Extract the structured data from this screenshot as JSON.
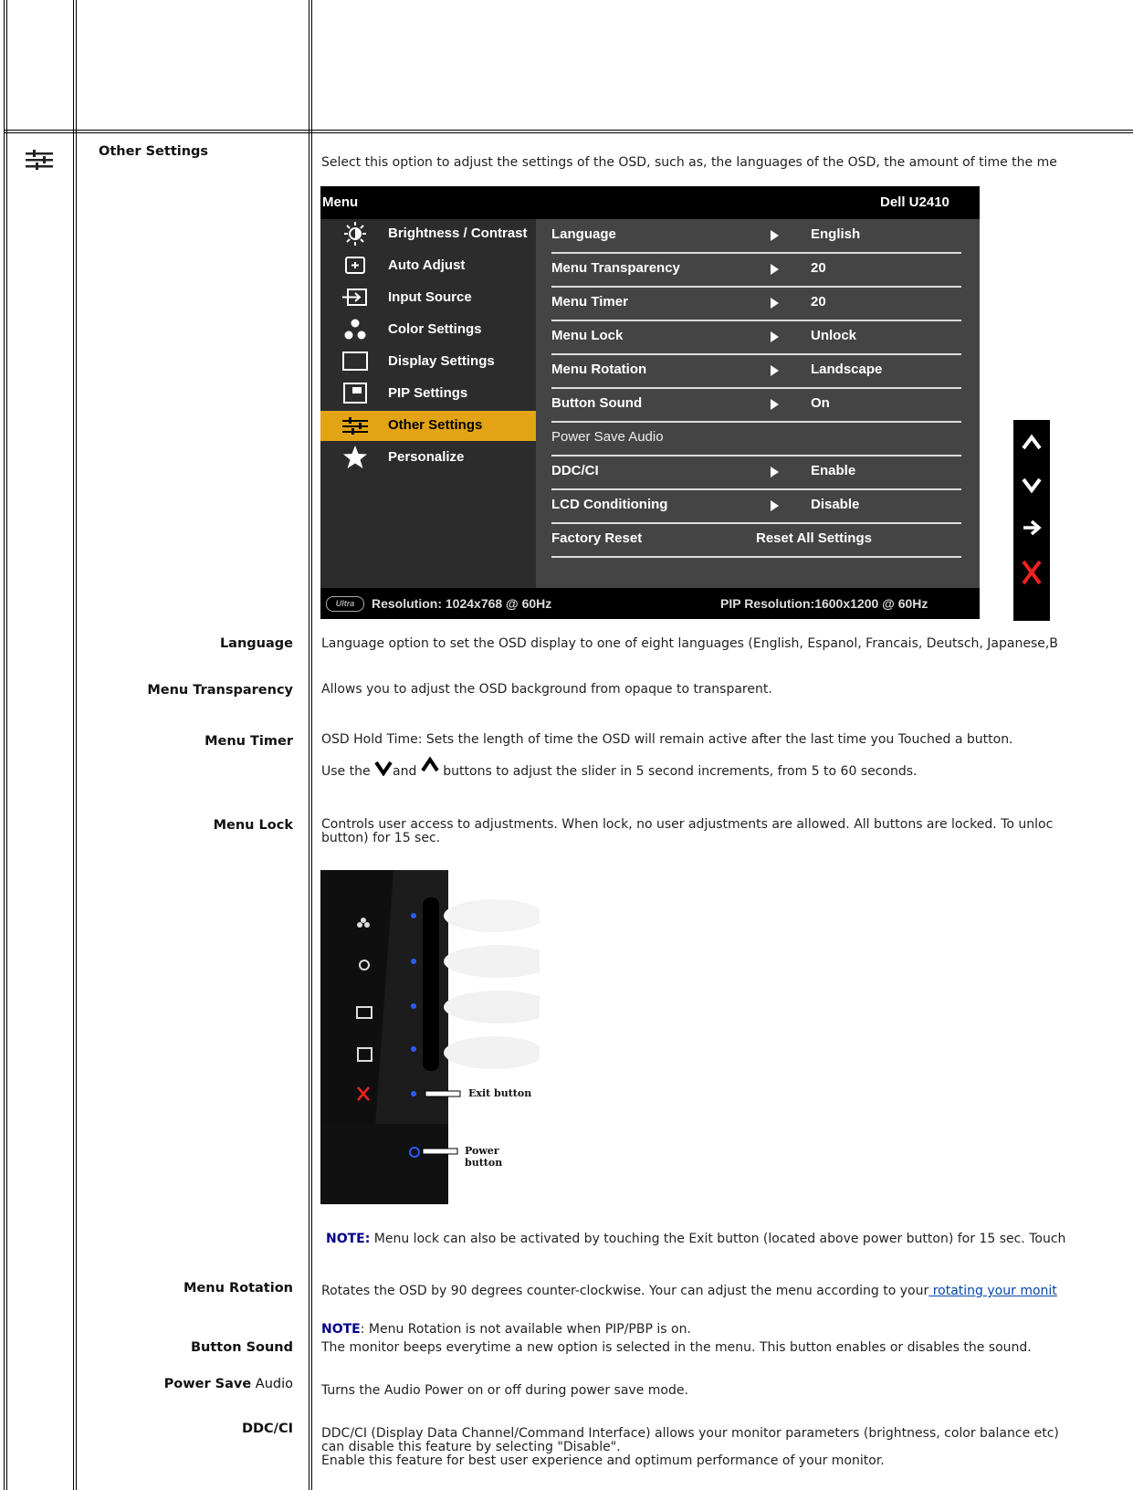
{
  "section": {
    "title": "Other Settings",
    "intro": "Select this option to adjust the settings of the OSD, such as, the languages of the OSD, the amount of time the me"
  },
  "icons": {
    "section": "other-settings-icon"
  },
  "osd": {
    "menu_title": "Menu",
    "model": "Dell U2410",
    "left_items": [
      {
        "label": "Brightness / Contrast"
      },
      {
        "label": "Auto Adjust"
      },
      {
        "label": "Input Source"
      },
      {
        "label": "Color Settings"
      },
      {
        "label": "Display Settings"
      },
      {
        "label": "PIP Settings"
      },
      {
        "label": "Other Settings"
      },
      {
        "label": "Personalize"
      }
    ],
    "rows": [
      {
        "key": "Language",
        "value": "English"
      },
      {
        "key": "Menu Transparency",
        "value": "20"
      },
      {
        "key": "Menu Timer",
        "value": "20"
      },
      {
        "key": "Menu Lock",
        "value": "Unlock"
      },
      {
        "key": "Menu Rotation",
        "value": "Landscape"
      },
      {
        "key": "Button Sound",
        "value": "On"
      },
      {
        "key": "Power Save Audio",
        "value": ""
      },
      {
        "key": "DDC/CI",
        "value": "Enable"
      },
      {
        "key": "LCD Conditioning",
        "value": "Disable"
      },
      {
        "key": "Factory Reset",
        "value": "Reset All Settings"
      }
    ],
    "footer_logo": "Ultra",
    "resolution": "Resolution: 1024x768 @ 60Hz",
    "pip_resolution": "PIP Resolution:1600x1200 @ 60Hz"
  },
  "items": {
    "language": {
      "label": "Language",
      "text": "Language option to set the OSD display to one of eight languages (English, Espanol, Francais, Deutsch, Japanese,B"
    },
    "transparency": {
      "label": "Menu Transparency",
      "text": "Allows you to adjust the OSD background from opaque to transparent."
    },
    "timer": {
      "label": "Menu Timer",
      "text1": "OSD Hold Time: Sets the length of time the OSD will remain active after the last time you Touched a button.",
      "text2a": "Use the",
      "text2b": "and",
      "text2c": "buttons to adjust the slider in 5 second increments, from 5 to 60 seconds."
    },
    "lock": {
      "label": "Menu Lock",
      "text": "Controls user access to adjustments. When lock, no user adjustments are allowed. All buttons are locked. To unloc",
      "text_cont": "button) for 15 sec.",
      "exit_button": "Exit button",
      "power_button": "Power button",
      "note_label": "NOTE:",
      "note": "Menu lock can also be activated by touching the Exit button (located above power button) for 15 sec. Touch"
    },
    "rotation": {
      "label": "Menu Rotation",
      "text": "Rotates the OSD by 90 degrees counter-clockwise. Your can adjust the menu according to your",
      "link": " rotating your monit",
      "note_label": "NOTE",
      "note": ": Menu Rotation is not available when PIP/PBP is on."
    },
    "sound": {
      "label": "Button Sound",
      "text": "The monitor beeps everytime a new option is selected in the menu. This button enables or disables the sound."
    },
    "psa": {
      "label_bold": "Power Save",
      "label_plain": " Audio",
      "text": "Turns the Audio Power on or off during power save mode."
    },
    "ddc": {
      "label": "DDC/CI",
      "text1": "DDC/CI (Display Data Channel/Command Interface) allows your monitor parameters (brightness, color balance etc)",
      "text2": "can disable this feature by selecting \"Disable\".",
      "text3": "Enable this feature for best user experience and optimum performance of your monitor."
    }
  }
}
